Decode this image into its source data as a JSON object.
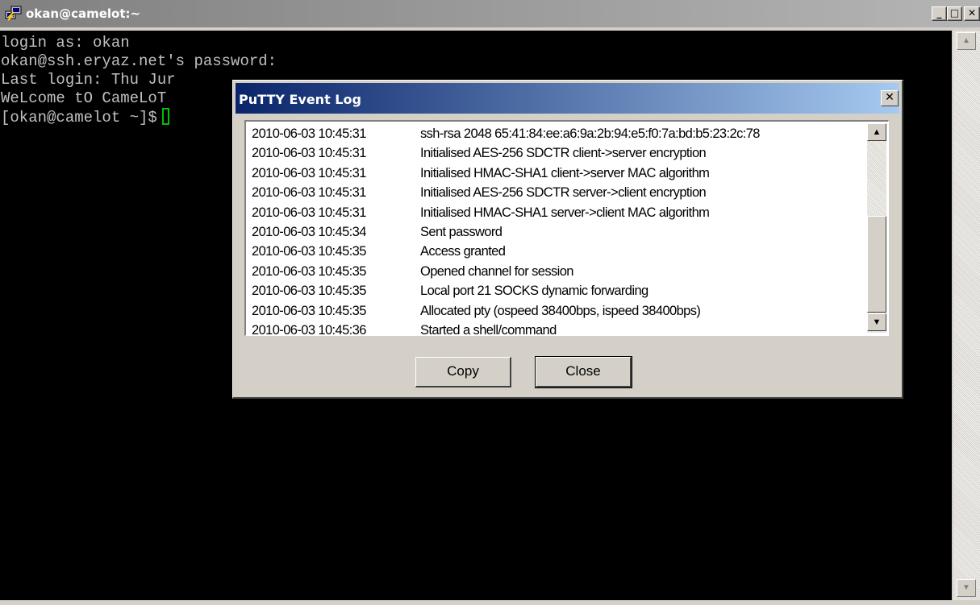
{
  "window": {
    "title": "okan@camelot:~",
    "min_glyph": "_",
    "max_glyph": "□",
    "close_glyph": "✕"
  },
  "terminal": {
    "lines": [
      "login as: okan",
      "okan@ssh.eryaz.net's password:",
      "Last login: Thu Jur",
      "WeLcome tO CameLoT",
      "[okan@camelot ~]$"
    ],
    "cursor_color": "#00c000"
  },
  "dialog": {
    "title": "PuTTY Event Log",
    "close_glyph": "✕",
    "log": [
      {
        "ts": "2010-06-03 10:45:31",
        "msg": "ssh-rsa 2048 65:41:84:ee:a6:9a:2b:94:e5:f0:7a:bd:b5:23:2c:78"
      },
      {
        "ts": "2010-06-03 10:45:31",
        "msg": "Initialised AES-256 SDCTR client->server encryption"
      },
      {
        "ts": "2010-06-03 10:45:31",
        "msg": "Initialised HMAC-SHA1 client->server MAC algorithm"
      },
      {
        "ts": "2010-06-03 10:45:31",
        "msg": "Initialised AES-256 SDCTR server->client encryption"
      },
      {
        "ts": "2010-06-03 10:45:31",
        "msg": "Initialised HMAC-SHA1 server->client MAC algorithm"
      },
      {
        "ts": "2010-06-03 10:45:34",
        "msg": "Sent password"
      },
      {
        "ts": "2010-06-03 10:45:35",
        "msg": "Access granted"
      },
      {
        "ts": "2010-06-03 10:45:35",
        "msg": "Opened channel for session"
      },
      {
        "ts": "2010-06-03 10:45:35",
        "msg": "Local port 21 SOCKS dynamic forwarding"
      },
      {
        "ts": "2010-06-03 10:45:35",
        "msg": "Allocated pty (ospeed 38400bps, ispeed 38400bps)"
      },
      {
        "ts": "2010-06-03 10:45:36",
        "msg": "Started a shell/command"
      }
    ],
    "copy_label": "Copy",
    "close_label": "Close"
  }
}
